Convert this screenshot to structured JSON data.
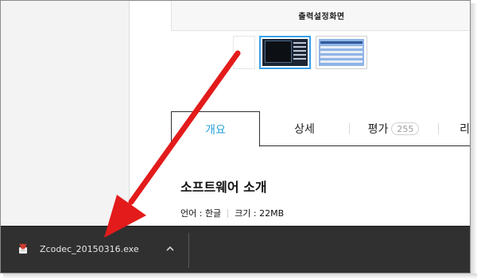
{
  "preview": {
    "caption": "출력설정화면"
  },
  "tabs": [
    {
      "label": "개요",
      "active": true
    },
    {
      "label": "상세"
    },
    {
      "label": "평가",
      "badge": "255"
    },
    {
      "label": "리"
    }
  ],
  "intro": {
    "title": "소프트웨어 소개",
    "language": "언어 : 한글",
    "size": "크기 : 22MB"
  },
  "download": {
    "filename": "Zcodec_20150316.exe"
  },
  "colors": {
    "accent": "#26a1d8",
    "arrow": "#e31b1b",
    "download_bar": "#303030"
  }
}
